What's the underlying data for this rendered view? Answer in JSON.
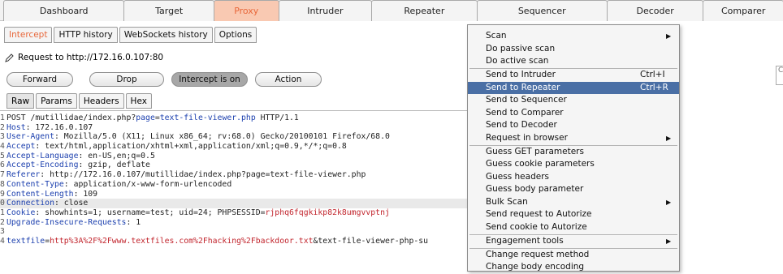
{
  "top_tabs": [
    {
      "label": "Dashboard",
      "w": 150
    },
    {
      "label": "Target",
      "w": 112
    },
    {
      "label": "Proxy",
      "w": 81
    },
    {
      "label": "Intruder",
      "w": 116
    },
    {
      "label": "Repeater",
      "w": 131
    },
    {
      "label": "Sequencer",
      "w": 162
    },
    {
      "label": "Decoder",
      "w": 120
    },
    {
      "label": "Comparer",
      "w": 100
    }
  ],
  "sub_tabs": {
    "intercept": "Intercept",
    "history": "HTTP history",
    "websockets": "WebSockets history",
    "options": "Options"
  },
  "request_label": "Request to http://172.16.0.107:80",
  "buttons": {
    "forward": "Forward",
    "drop": "Drop",
    "intercept": "Intercept is on",
    "action": "Action"
  },
  "view_tabs": {
    "raw": "Raw",
    "params": "Params",
    "headers": "Headers",
    "hex": "Hex"
  },
  "request_lines": [
    {
      "n": "1",
      "a": "POST /mutillidae/index.php?",
      "b": "page",
      "c": "=",
      "d": "text-file-viewer.php",
      "e": " HTTP/1.1"
    },
    {
      "n": "2",
      "a": "",
      "b": "Host",
      "c": ": 172.16.0.107",
      "d": "",
      "e": ""
    },
    {
      "n": "3",
      "a": "",
      "b": "User-Agent",
      "c": ": Mozilla/5.0 (X11; Linux x86_64; rv:68.0) Gecko/20100101 Firefox/68.0",
      "d": "",
      "e": ""
    },
    {
      "n": "4",
      "a": "",
      "b": "Accept",
      "c": ": text/html,application/xhtml+xml,application/xml;q=0.9,*/*;q=0.8",
      "d": "",
      "e": ""
    },
    {
      "n": "5",
      "a": "",
      "b": "Accept-Language",
      "c": ": en-US,en;q=0.5",
      "d": "",
      "e": ""
    },
    {
      "n": "6",
      "a": "",
      "b": "Accept-Encoding",
      "c": ": gzip, deflate",
      "d": "",
      "e": ""
    },
    {
      "n": "7",
      "a": "",
      "b": "Referer",
      "c": ": http://172.16.0.107/mutillidae/index.php?page=text-file-viewer.php",
      "d": "",
      "e": ""
    },
    {
      "n": "8",
      "a": "",
      "b": "Content-Type",
      "c": ": application/x-www-form-urlencoded",
      "d": "",
      "e": ""
    },
    {
      "n": "9",
      "a": "",
      "b": "Content-Length",
      "c": ": 109",
      "d": "",
      "e": ""
    },
    {
      "n": "0",
      "a": "",
      "b": "Connection",
      "c": ": close",
      "d": "",
      "e": ""
    },
    {
      "n": "1",
      "a": "",
      "b": "Cookie",
      "c": ": showhints=1; username=test; uid=24; PHPSESSID=",
      "d": "rjphq6fqgkikp82k8umgvvptnj",
      "e": ""
    },
    {
      "n": "2",
      "a": "",
      "b": "Upgrade-Insecure-Requests",
      "c": ": 1",
      "d": "",
      "e": ""
    },
    {
      "n": "3",
      "a": "",
      "b": "",
      "c": "",
      "d": "",
      "e": ""
    },
    {
      "n": "4",
      "a": "",
      "b": "textfile",
      "c": "=",
      "d": "http%3A%2F%2Fwww.textfiles.com%2Fhacking%2Fbackdoor.txt",
      "e": "&text-file-viewer-php-su"
    }
  ],
  "context_menu": {
    "items": [
      {
        "label": "Scan",
        "shortcut": "",
        "arrow": "▶"
      },
      {
        "label": "Do passive scan",
        "shortcut": "",
        "arrow": ""
      },
      {
        "label": "Do active scan",
        "shortcut": "",
        "arrow": ""
      },
      {
        "label": "Send to Intruder",
        "shortcut": "Ctrl+I",
        "arrow": ""
      },
      {
        "label": "Send to Repeater",
        "shortcut": "Ctrl+R",
        "arrow": "",
        "selected": true
      },
      {
        "label": "Send to Sequencer",
        "shortcut": "",
        "arrow": ""
      },
      {
        "label": "Send to Comparer",
        "shortcut": "",
        "arrow": ""
      },
      {
        "label": "Send to Decoder",
        "shortcut": "",
        "arrow": ""
      },
      {
        "label": "Request in browser",
        "shortcut": "",
        "arrow": "▶"
      },
      {
        "label": "Guess GET parameters",
        "shortcut": "",
        "arrow": ""
      },
      {
        "label": "Guess cookie parameters",
        "shortcut": "",
        "arrow": ""
      },
      {
        "label": "Guess headers",
        "shortcut": "",
        "arrow": ""
      },
      {
        "label": "Guess body parameter",
        "shortcut": "",
        "arrow": ""
      },
      {
        "label": "Bulk Scan",
        "shortcut": "",
        "arrow": "▶"
      },
      {
        "label": "Send request to Autorize",
        "shortcut": "",
        "arrow": ""
      },
      {
        "label": "Send cookie to Autorize",
        "shortcut": "",
        "arrow": ""
      },
      {
        "label": "Engagement tools",
        "shortcut": "",
        "arrow": "▶"
      },
      {
        "label": "Change request method",
        "shortcut": "",
        "arrow": ""
      },
      {
        "label": "Change body encoding",
        "shortcut": "",
        "arrow": ""
      }
    ]
  },
  "search_glyph": "C",
  "colors": {
    "accent": "#e8673a",
    "selection": "#4a6fa5",
    "header_name": "#1b3fae",
    "value_red": "#c2262e"
  }
}
